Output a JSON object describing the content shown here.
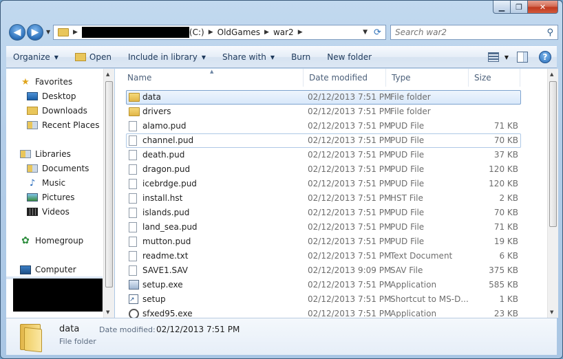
{
  "window": {
    "caption": {
      "minimize": "▁",
      "maximize": "❐",
      "close": "✕"
    }
  },
  "address": {
    "drive_label": "(C:)",
    "crumbs": [
      "OldGames",
      "war2"
    ]
  },
  "search": {
    "placeholder": "Search war2"
  },
  "toolbar": {
    "organize": "Organize",
    "open": "Open",
    "include": "Include in library",
    "share": "Share with",
    "burn": "Burn",
    "new_folder": "New folder",
    "help": "?"
  },
  "nav": {
    "favorites": "Favorites",
    "desktop": "Desktop",
    "downloads": "Downloads",
    "recent": "Recent Places",
    "libraries": "Libraries",
    "documents": "Documents",
    "music": "Music",
    "pictures": "Pictures",
    "videos": "Videos",
    "homegroup": "Homegroup",
    "computer": "Computer"
  },
  "columns": {
    "name": "Name",
    "date": "Date modified",
    "type": "Type",
    "size": "Size"
  },
  "files": [
    {
      "name": "data",
      "date": "02/12/2013 7:51 PM",
      "type": "File folder",
      "size": "",
      "icon": "folder-icon"
    },
    {
      "name": "drivers",
      "date": "02/12/2013 7:51 PM",
      "type": "File folder",
      "size": "",
      "icon": "folder-icon"
    },
    {
      "name": "alamo.pud",
      "date": "02/12/2013 7:51 PM",
      "type": "PUD File",
      "size": "71 KB",
      "icon": "file-icon"
    },
    {
      "name": "channel.pud",
      "date": "02/12/2013 7:51 PM",
      "type": "PUD File",
      "size": "70 KB",
      "icon": "file-icon"
    },
    {
      "name": "death.pud",
      "date": "02/12/2013 7:51 PM",
      "type": "PUD File",
      "size": "37 KB",
      "icon": "file-icon"
    },
    {
      "name": "dragon.pud",
      "date": "02/12/2013 7:51 PM",
      "type": "PUD File",
      "size": "120 KB",
      "icon": "file-icon"
    },
    {
      "name": "icebrdge.pud",
      "date": "02/12/2013 7:51 PM",
      "type": "PUD File",
      "size": "120 KB",
      "icon": "file-icon"
    },
    {
      "name": "install.hst",
      "date": "02/12/2013 7:51 PM",
      "type": "HST File",
      "size": "2 KB",
      "icon": "file-icon"
    },
    {
      "name": "islands.pud",
      "date": "02/12/2013 7:51 PM",
      "type": "PUD File",
      "size": "70 KB",
      "icon": "file-icon"
    },
    {
      "name": "land_sea.pud",
      "date": "02/12/2013 7:51 PM",
      "type": "PUD File",
      "size": "71 KB",
      "icon": "file-icon"
    },
    {
      "name": "mutton.pud",
      "date": "02/12/2013 7:51 PM",
      "type": "PUD File",
      "size": "19 KB",
      "icon": "file-icon"
    },
    {
      "name": "readme.txt",
      "date": "02/12/2013 7:51 PM",
      "type": "Text Document",
      "size": "6 KB",
      "icon": "text-file-icon"
    },
    {
      "name": "SAVE1.SAV",
      "date": "02/12/2013 9:09 PM",
      "type": "SAV File",
      "size": "375 KB",
      "icon": "file-icon"
    },
    {
      "name": "setup.exe",
      "date": "02/12/2013 7:51 PM",
      "type": "Application",
      "size": "585 KB",
      "icon": "application-icon"
    },
    {
      "name": "setup",
      "date": "02/12/2013 7:51 PM",
      "type": "Shortcut to MS-D...",
      "size": "1 KB",
      "icon": "shortcut-icon"
    },
    {
      "name": "sfxed95.exe",
      "date": "02/12/2013 7:51 PM",
      "type": "Application",
      "size": "23 KB",
      "icon": "sfx-application-icon"
    }
  ],
  "details": {
    "name": "data",
    "date_label": "Date modified:",
    "date_value": "02/12/2013 7:51 PM",
    "type": "File folder"
  }
}
